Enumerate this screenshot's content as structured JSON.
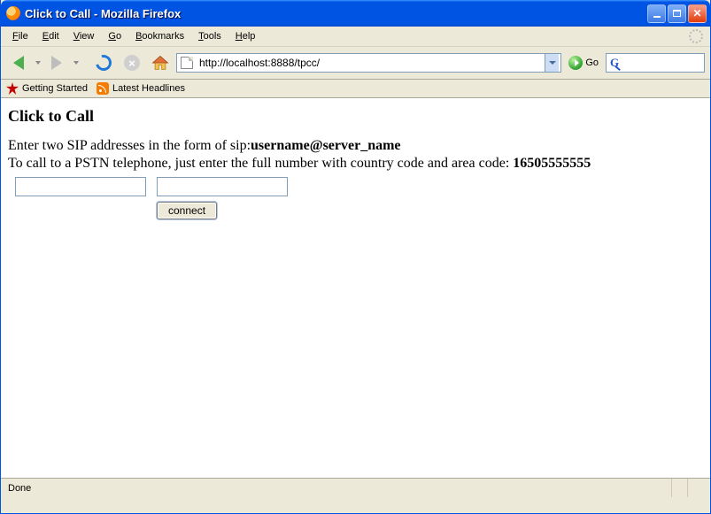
{
  "window": {
    "title": "Click to Call - Mozilla Firefox"
  },
  "menubar": {
    "file": "File",
    "edit": "Edit",
    "view": "View",
    "go": "Go",
    "bookmarks": "Bookmarks",
    "tools": "Tools",
    "help": "Help"
  },
  "toolbar": {
    "address": "http://localhost:8888/tpcc/",
    "go_label": "Go"
  },
  "bookmarks_bar": {
    "getting_started": "Getting Started",
    "latest_headlines": "Latest Headlines"
  },
  "page": {
    "heading": "Click to Call",
    "line1_prefix": "Enter two SIP addresses in the form of sip:",
    "line1_bold": "username@server_name",
    "line2_prefix": "To call to a PSTN telephone, just enter the full number with country code and area code: ",
    "line2_bold": "16505555555",
    "input1": "",
    "input2": "",
    "connect_label": "connect"
  },
  "statusbar": {
    "text": "Done"
  }
}
